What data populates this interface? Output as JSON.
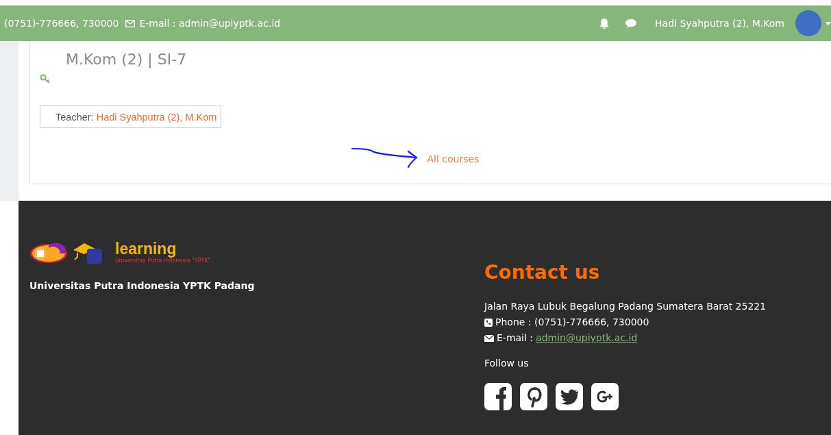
{
  "header": {
    "phone": "(0751)-776666, 730000",
    "email": "E-mail : admin@upiyptk.ac.id",
    "user_name": "Hadi Syahputra (2), M.Kom"
  },
  "course": {
    "title_tail": "M.Kom (2) | SI-7",
    "teacher_label": "Teacher:",
    "teacher_name": "Hadi Syahputra (2), M.Kom"
  },
  "all_courses": "All courses",
  "footer": {
    "logo_text": "learning",
    "logo_subtitle": "Universitas Putra Indonesia \"YPTK\"",
    "university": "Universitas Putra Indonesia YPTK Padang",
    "contact_title": "Contact us",
    "address": "Jalan Raya Lubuk Begalung Padang Sumatera Barat 25221",
    "phone": "Phone : (0751)-776666, 730000",
    "email_label": "E-mail :",
    "email": "admin@upiyptk.ac.id",
    "follow": "Follow us",
    "socials": [
      {
        "kind": "facebook"
      },
      {
        "kind": "pinterest"
      },
      {
        "kind": "twitter"
      },
      {
        "kind": "googleplus"
      }
    ]
  }
}
